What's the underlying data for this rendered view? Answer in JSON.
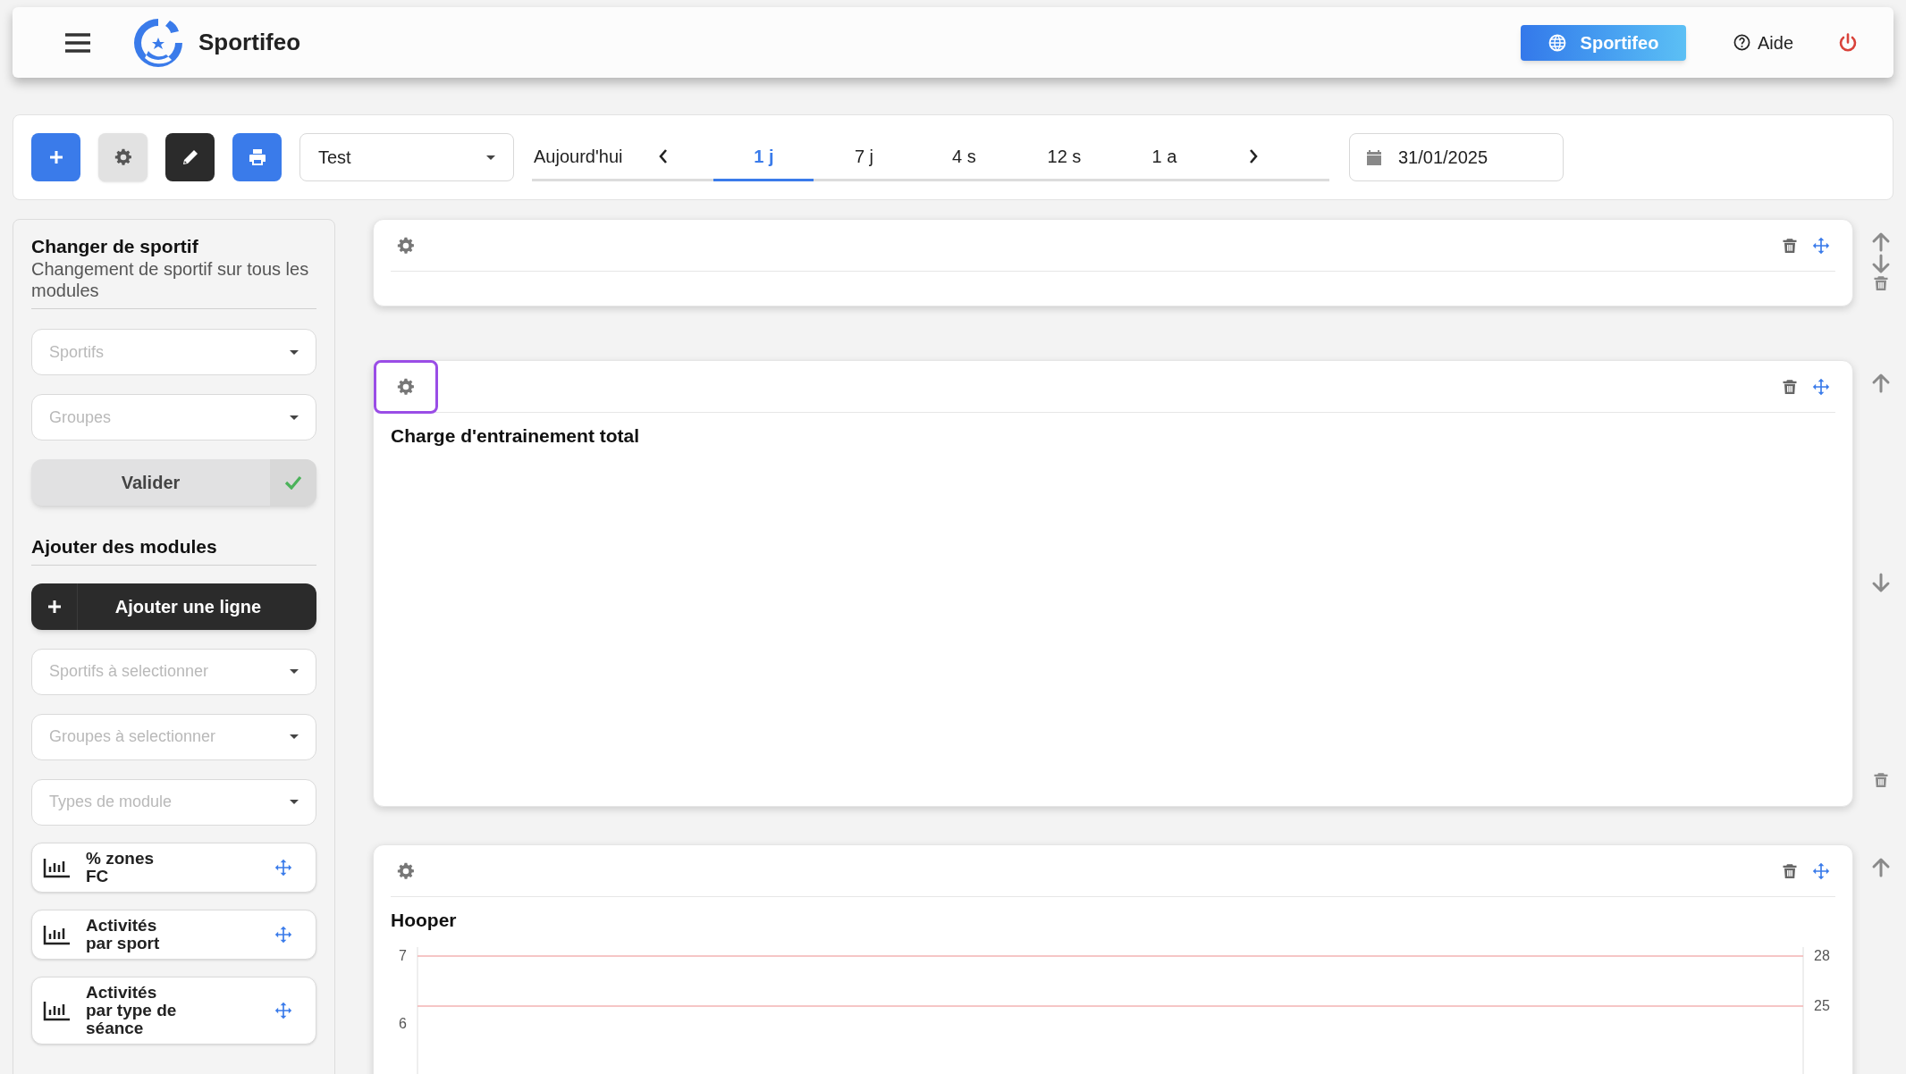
{
  "header": {
    "app_name": "Sportifeo",
    "site_button": "Sportifeo",
    "help": "Aide"
  },
  "toolbar": {
    "view_select": "Test",
    "today": "Aujourd'hui",
    "periods": [
      {
        "label": "1 j",
        "selected": true
      },
      {
        "label": "7 j",
        "selected": false
      },
      {
        "label": "4 s",
        "selected": false
      },
      {
        "label": "12 s",
        "selected": false
      },
      {
        "label": "1 a",
        "selected": false
      }
    ],
    "date": "31/01/2025"
  },
  "sidebar": {
    "change_title": "Changer de sportif",
    "change_subtitle": "Changement de sportif sur tous les modules",
    "change_selects": [
      {
        "placeholder": "Sportifs"
      },
      {
        "placeholder": "Groupes"
      }
    ],
    "validate": "Valider",
    "add_title": "Ajouter des modules",
    "add_row": "Ajouter une ligne",
    "module_selects": [
      {
        "placeholder": "Sportifs à selectionner"
      },
      {
        "placeholder": "Groupes à selectionner"
      },
      {
        "placeholder": "Types de module"
      }
    ],
    "modules": [
      {
        "label": "% zones FC"
      },
      {
        "label": "Activités par sport"
      },
      {
        "label": "Activités par type de séance"
      }
    ]
  },
  "rows": [
    {
      "settings_focused": false,
      "side_actions": [
        {
          "kind": "up"
        },
        {
          "kind": "down"
        },
        {
          "kind": "delete"
        }
      ]
    },
    {
      "title": "Charge d'entrainement total",
      "settings_focused": true,
      "side_actions": [
        {
          "kind": "up"
        },
        {
          "kind": "down"
        },
        {
          "kind": "delete"
        }
      ]
    },
    {
      "title": "Hooper",
      "settings_focused": false,
      "side_actions": [
        {
          "kind": "up"
        }
      ],
      "chart_axes": {
        "left_ticks": [
          "7",
          "6"
        ],
        "right_ticks": [
          "28",
          "25"
        ]
      }
    }
  ]
}
